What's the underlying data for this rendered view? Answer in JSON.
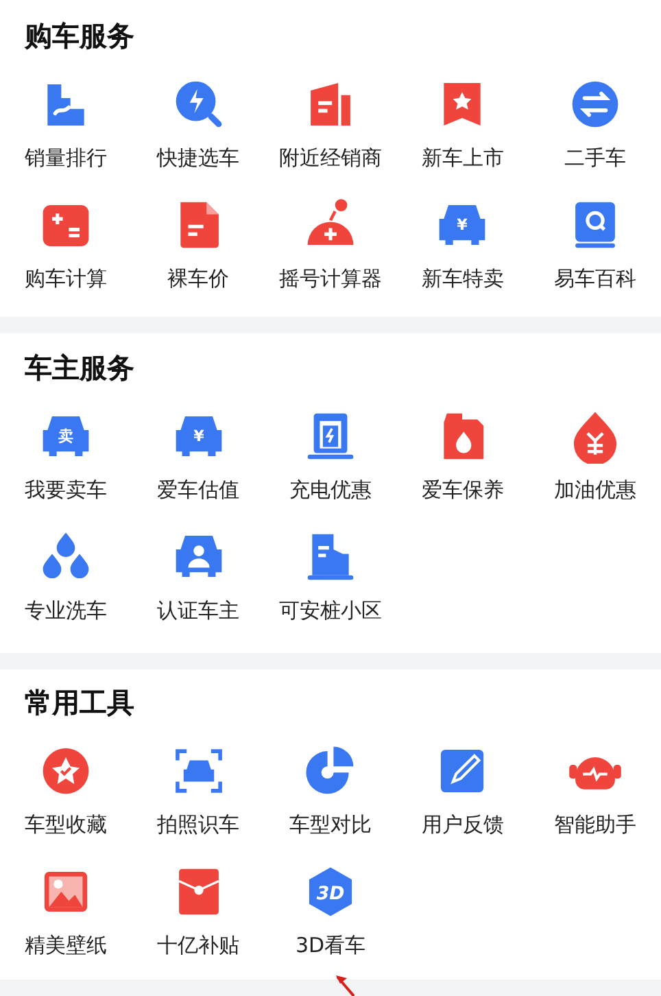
{
  "sections": [
    {
      "title": "购车服务",
      "items": [
        {
          "label": "销量排行",
          "kind": "ranking"
        },
        {
          "label": "快捷选车",
          "kind": "quick"
        },
        {
          "label": "附近经销商",
          "kind": "dealer"
        },
        {
          "label": "新车上市",
          "kind": "newcar"
        },
        {
          "label": "二手车",
          "kind": "swap"
        },
        {
          "label": "购车计算",
          "kind": "calc"
        },
        {
          "label": "裸车价",
          "kind": "doc"
        },
        {
          "label": "摇号计算器",
          "kind": "lottery"
        },
        {
          "label": "新车特卖",
          "kind": "carsale",
          "badge": "¥"
        },
        {
          "label": "易车百科",
          "kind": "book"
        }
      ]
    },
    {
      "title": "车主服务",
      "items": [
        {
          "label": "我要卖车",
          "kind": "sellcar",
          "badge": "卖"
        },
        {
          "label": "爱车估值",
          "kind": "carsale",
          "badge": "¥"
        },
        {
          "label": "充电优惠",
          "kind": "charger"
        },
        {
          "label": "爱车保养",
          "kind": "oil"
        },
        {
          "label": "加油优惠",
          "kind": "drop"
        },
        {
          "label": "专业洗车",
          "kind": "wash"
        },
        {
          "label": "认证车主",
          "kind": "owner"
        },
        {
          "label": "可安桩小区",
          "kind": "building"
        }
      ]
    },
    {
      "title": "常用工具",
      "items": [
        {
          "label": "车型收藏",
          "kind": "favorite"
        },
        {
          "label": "拍照识车",
          "kind": "scan"
        },
        {
          "label": "车型对比",
          "kind": "pie"
        },
        {
          "label": "用户反馈",
          "kind": "edit"
        },
        {
          "label": "智能助手",
          "kind": "robot"
        },
        {
          "label": "精美壁纸",
          "kind": "image"
        },
        {
          "label": "十亿补贴",
          "kind": "envelope"
        },
        {
          "label": "3D看车",
          "kind": "hex",
          "badge": "3D"
        }
      ]
    }
  ],
  "pointer_arrow": true
}
